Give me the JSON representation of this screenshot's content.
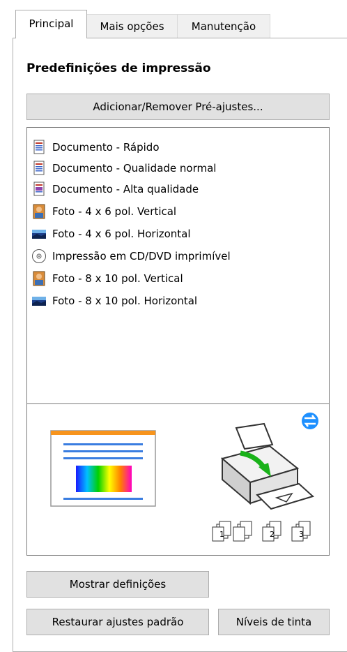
{
  "tabs": [
    {
      "label": "Principal",
      "active": true
    },
    {
      "label": "Mais opções",
      "active": false
    },
    {
      "label": "Manutenção",
      "active": false
    }
  ],
  "presets": {
    "title": "Predefinições de impressão",
    "add_remove_button": "Adicionar/Remover Pré-ajustes...",
    "items": [
      {
        "label": "Documento - Rápido",
        "icon": "document-icon"
      },
      {
        "label": "Documento - Qualidade normal",
        "icon": "document-icon"
      },
      {
        "label": "Documento - Alta qualidade",
        "icon": "document-color-icon"
      },
      {
        "label": "Foto - 4 x 6 pol. Vertical",
        "icon": "photo-portrait-icon"
      },
      {
        "label": "Foto - 4 x 6 pol. Horizontal",
        "icon": "photo-landscape-icon"
      },
      {
        "label": "Impressão em CD/DVD imprimível",
        "icon": "cd-icon"
      },
      {
        "label": "Foto - 8 x 10 pol. Vertical",
        "icon": "photo-portrait-icon"
      },
      {
        "label": "Foto - 8 x 10 pol. Horizontal",
        "icon": "photo-landscape-icon"
      }
    ]
  },
  "preview": {
    "copies": [
      "1",
      "2",
      "3"
    ]
  },
  "buttons": {
    "show_settings": "Mostrar definições",
    "restore_defaults": "Restaurar ajustes padrão",
    "ink_levels": "Níveis de tinta"
  },
  "colors": {
    "accent_blue": "#1e90ff",
    "arrow_green": "#19b219",
    "header_orange": "#f7941d"
  }
}
